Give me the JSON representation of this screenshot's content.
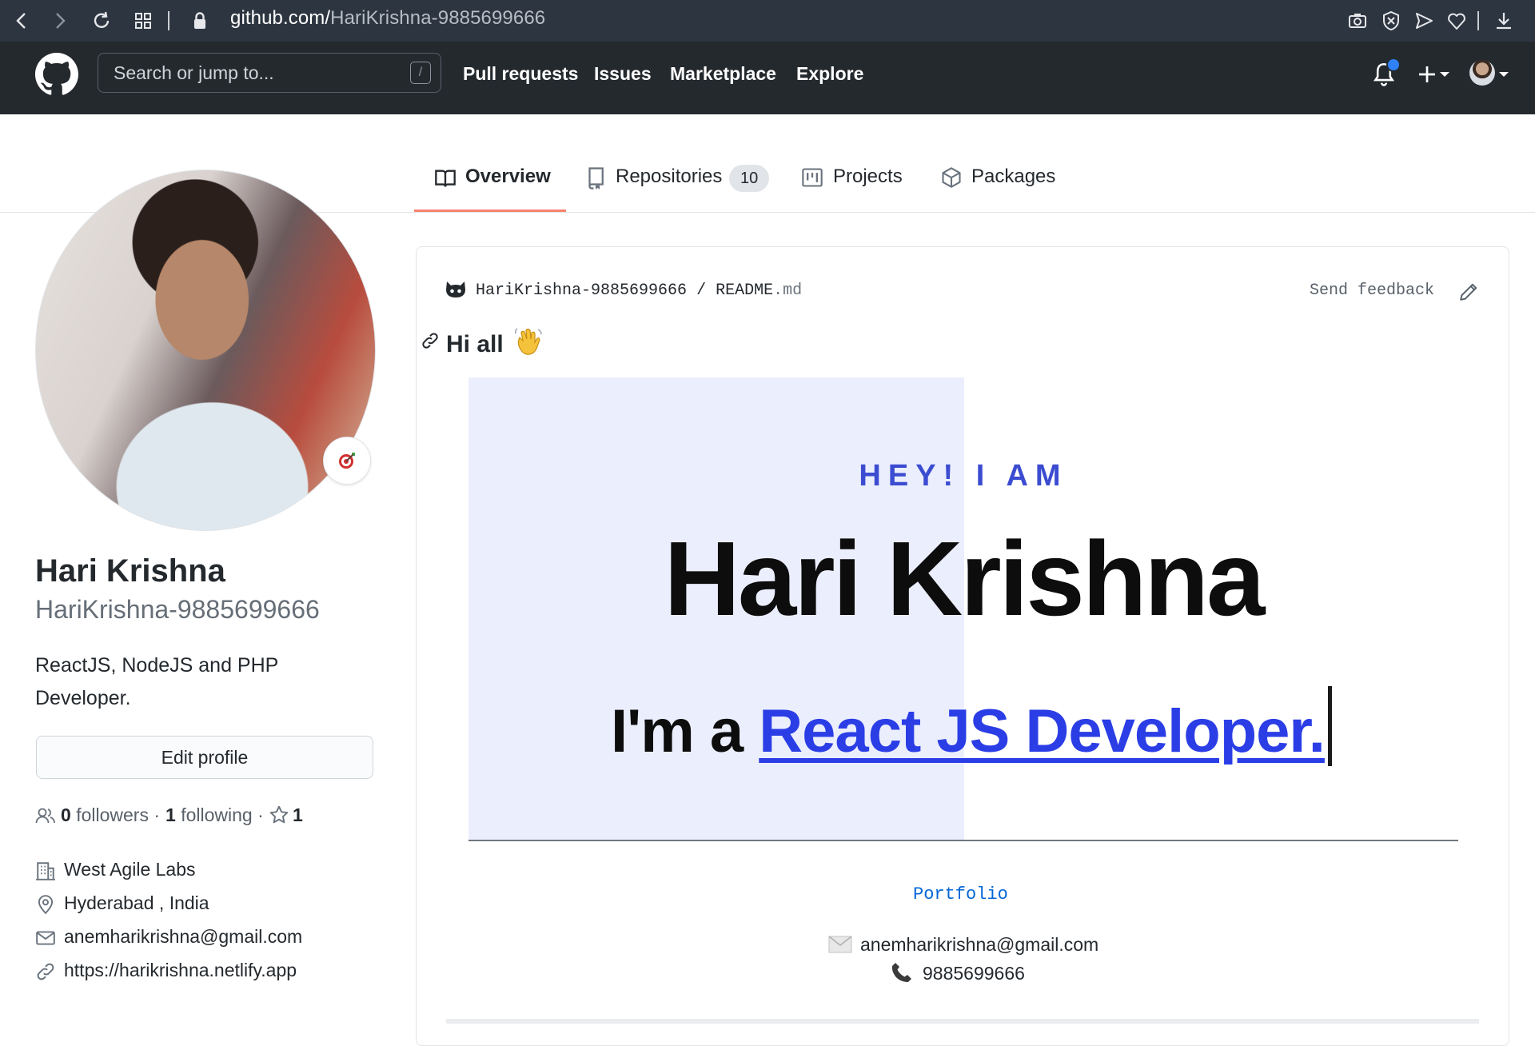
{
  "browser": {
    "url_host": "github.com/",
    "url_path": "HariKrishna-9885699666"
  },
  "header": {
    "search_placeholder": "Search or jump to...",
    "search_shortcut": "/",
    "nav": [
      "Pull requests",
      "Issues",
      "Marketplace",
      "Explore"
    ]
  },
  "tabs": {
    "overview": "Overview",
    "repositories": "Repositories",
    "repositories_count": "10",
    "projects": "Projects",
    "packages": "Packages"
  },
  "profile": {
    "full_name": "Hari Krishna",
    "username": "HariKrishna-9885699666",
    "bio": "ReactJS, NodeJS and PHP Developer.",
    "edit_button": "Edit profile",
    "followers_count": "0",
    "followers_label": "followers",
    "following_count": "1",
    "following_label": "following",
    "stars_count": "1",
    "company": "West Agile Labs",
    "location": "Hyderabad , India",
    "email": "anemharikrishna@gmail.com",
    "website": "https://harikrishna.netlify.app"
  },
  "readme": {
    "repo": "HariKrishna-9885699666",
    "separator": "/",
    "file_name": "README",
    "file_ext": ".md",
    "send_feedback": "Send feedback",
    "heading": "Hi all",
    "banner_hey": "HEY! I AM",
    "banner_name": "Hari Krishna",
    "banner_role_prefix": "I'm a",
    "banner_role": "React JS Developer.",
    "portfolio_link": "Portfolio",
    "contact_email": "anemharikrishna@gmail.com",
    "contact_phone": "9885699666"
  },
  "colors": {
    "header_bg": "#24292e",
    "tab_underline": "#f9826c",
    "link": "#0366d6",
    "banner_accent": "#2b3ee6"
  }
}
